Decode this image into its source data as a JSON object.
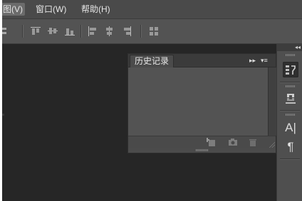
{
  "menubar": {
    "items": [
      {
        "label": "图(V)"
      },
      {
        "label": "窗口(W)"
      },
      {
        "label": "帮助(H)"
      }
    ]
  },
  "options_bar": {
    "icons": [
      "align-top-icon",
      "align-vertical-center-icon",
      "align-bottom-icon",
      "align-left-icon",
      "align-horizontal-center-icon",
      "align-right-icon",
      "auto-align-icon"
    ]
  },
  "history_panel": {
    "tab_label": "历史记录",
    "footer_icons": [
      "new-document-from-state-icon",
      "camera-icon",
      "trash-icon"
    ]
  },
  "dock": {
    "collapse_glyph": "◂◂",
    "buttons": [
      {
        "icon": "history-icon",
        "active": true
      },
      {
        "icon": "layer-comps-icon",
        "active": false
      },
      {
        "icon": "character-icon",
        "text": "A|"
      },
      {
        "icon": "paragraph-icon",
        "text": "¶"
      }
    ]
  },
  "panel_controls": {
    "expand": "▸▸",
    "menu": "▾≡"
  },
  "colors": {
    "app_bg": "#535353",
    "canvas_bg": "#262626",
    "panel_bg": "#535353",
    "text": "#e6e6e6"
  }
}
